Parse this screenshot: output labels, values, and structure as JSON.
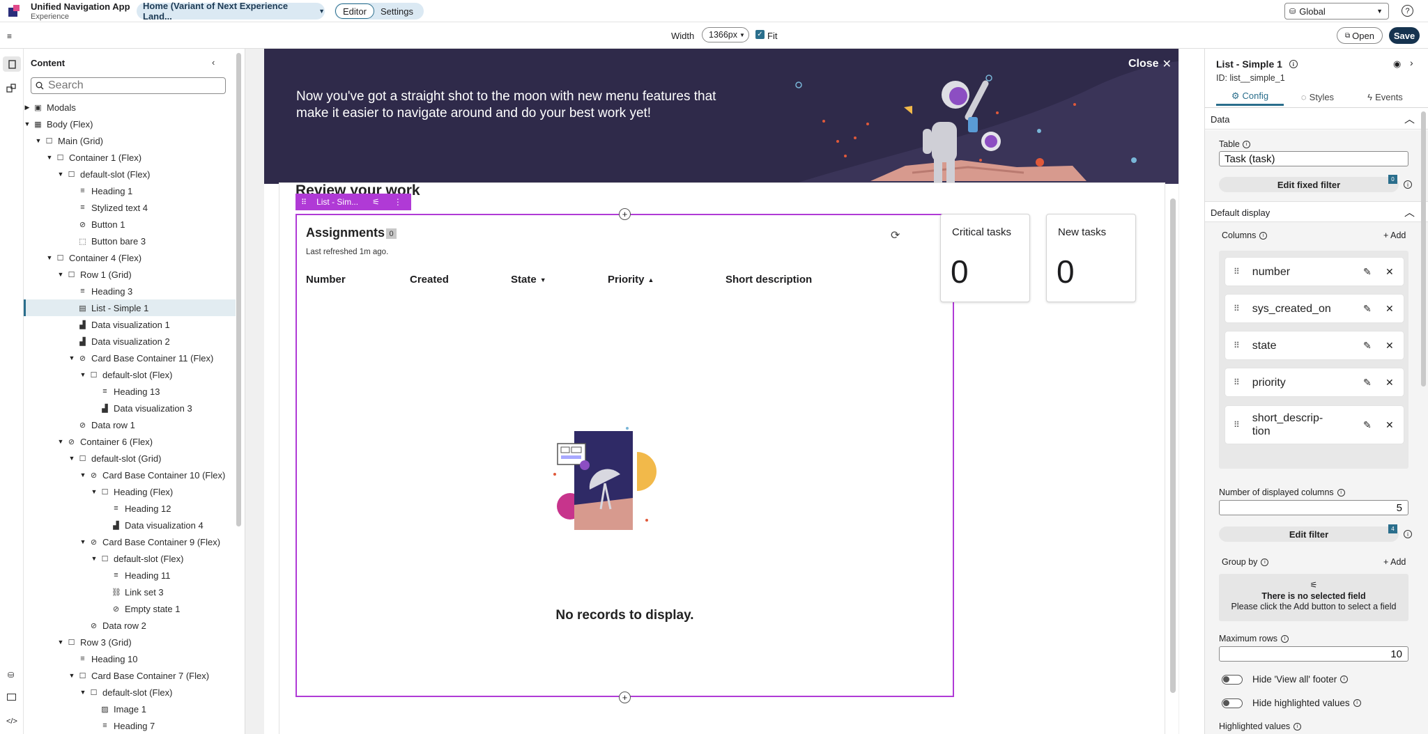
{
  "app": {
    "title": "Unified Navigation App",
    "subtitle": "Experience",
    "page_selector": "Home (Variant of Next Experience Land...",
    "mode_editor": "Editor",
    "mode_settings": "Settings",
    "scope": "Global"
  },
  "toolbar": {
    "width_label": "Width",
    "width_value": "1366px",
    "fit_label": "Fit",
    "open_label": "Open",
    "save_label": "Save"
  },
  "content_panel": {
    "title": "Content",
    "search_placeholder": "Search",
    "tree": [
      {
        "label": "Modals",
        "depth": 0,
        "caret": "▶",
        "icon": "modal"
      },
      {
        "label": "Body (Flex)",
        "depth": 0,
        "caret": "▼",
        "icon": "layout"
      },
      {
        "label": "Main (Grid)",
        "depth": 1,
        "caret": "▼",
        "icon": "box"
      },
      {
        "label": "Container 1 (Flex)",
        "depth": 2,
        "caret": "▼",
        "icon": "box"
      },
      {
        "label": "default-slot (Flex)",
        "depth": 3,
        "caret": "▼",
        "icon": "box"
      },
      {
        "label": "Heading 1",
        "depth": 4,
        "caret": "",
        "icon": "text"
      },
      {
        "label": "Stylized text 4",
        "depth": 4,
        "caret": "",
        "icon": "text"
      },
      {
        "label": "Button 1",
        "depth": 4,
        "caret": "",
        "icon": "eye-off"
      },
      {
        "label": "Button bare 3",
        "depth": 4,
        "caret": "",
        "icon": "cursor"
      },
      {
        "label": "Container 4 (Flex)",
        "depth": 2,
        "caret": "▼",
        "icon": "box"
      },
      {
        "label": "Row 1 (Grid)",
        "depth": 3,
        "caret": "▼",
        "icon": "box"
      },
      {
        "label": "Heading 3",
        "depth": 4,
        "caret": "",
        "icon": "text"
      },
      {
        "label": "List - Simple 1",
        "depth": 4,
        "caret": "",
        "icon": "list",
        "selected": true
      },
      {
        "label": "Data visualization 1",
        "depth": 4,
        "caret": "",
        "icon": "viz"
      },
      {
        "label": "Data visualization 2",
        "depth": 4,
        "caret": "",
        "icon": "viz"
      },
      {
        "label": "Card Base Container 11 (Flex)",
        "depth": 4,
        "caret": "▼",
        "icon": "eye-off"
      },
      {
        "label": "default-slot (Flex)",
        "depth": 5,
        "caret": "▼",
        "icon": "box"
      },
      {
        "label": "Heading 13",
        "depth": 6,
        "caret": "",
        "icon": "text"
      },
      {
        "label": "Data visualization 3",
        "depth": 6,
        "caret": "",
        "icon": "viz"
      },
      {
        "label": "Data row 1",
        "depth": 4,
        "caret": "",
        "icon": "eye-off"
      },
      {
        "label": "Container 6 (Flex)",
        "depth": 3,
        "caret": "▼",
        "icon": "eye-off"
      },
      {
        "label": "default-slot (Grid)",
        "depth": 4,
        "caret": "▼",
        "icon": "box"
      },
      {
        "label": "Card Base Container 10 (Flex)",
        "depth": 5,
        "caret": "▼",
        "icon": "eye-off"
      },
      {
        "label": "Heading (Flex)",
        "depth": 6,
        "caret": "▼",
        "icon": "box"
      },
      {
        "label": "Heading 12",
        "depth": 7,
        "caret": "",
        "icon": "text"
      },
      {
        "label": "Data visualization 4",
        "depth": 7,
        "caret": "",
        "icon": "viz"
      },
      {
        "label": "Card Base Container 9 (Flex)",
        "depth": 5,
        "caret": "▼",
        "icon": "eye-off"
      },
      {
        "label": "default-slot (Flex)",
        "depth": 6,
        "caret": "▼",
        "icon": "box"
      },
      {
        "label": "Heading 11",
        "depth": 7,
        "caret": "",
        "icon": "text"
      },
      {
        "label": "Link set 3",
        "depth": 7,
        "caret": "",
        "icon": "link"
      },
      {
        "label": "Empty state 1",
        "depth": 7,
        "caret": "",
        "icon": "eye-off"
      },
      {
        "label": "Data row 2",
        "depth": 5,
        "caret": "",
        "icon": "eye-off"
      },
      {
        "label": "Row 3 (Grid)",
        "depth": 3,
        "caret": "▼",
        "icon": "box"
      },
      {
        "label": "Heading 10",
        "depth": 4,
        "caret": "",
        "icon": "text"
      },
      {
        "label": "Card Base Container 7 (Flex)",
        "depth": 4,
        "caret": "▼",
        "icon": "box"
      },
      {
        "label": "default-slot (Flex)",
        "depth": 5,
        "caret": "▼",
        "icon": "box"
      },
      {
        "label": "Image 1",
        "depth": 6,
        "caret": "",
        "icon": "image"
      },
      {
        "label": "Heading 7",
        "depth": 6,
        "caret": "",
        "icon": "text"
      }
    ]
  },
  "canvas": {
    "banner_text_1": "Now you've got a straight shot to the moon with new menu features that",
    "banner_text_2": "make it easier to navigate around and do your best work yet!",
    "close_label": "Close",
    "section_heading": "Review your work",
    "component_chip": "List - Sim...",
    "list": {
      "title": "Assignments",
      "count": "0",
      "refreshed": "Last refreshed 1m ago.",
      "columns": [
        "Number",
        "Created",
        "State",
        "Priority",
        "Short description"
      ],
      "empty": "No records to display."
    },
    "cards": [
      {
        "title": "Critical tasks",
        "value": "0"
      },
      {
        "title": "New tasks",
        "value": "0"
      }
    ]
  },
  "config": {
    "title": "List - Simple 1",
    "id_label": "ID: list__simple_1",
    "tabs": [
      "Config",
      "Styles",
      "Events"
    ],
    "section_data": "Data",
    "table_label": "Table",
    "table_value": "Task (task)",
    "fixed_filter_label": "Edit fixed filter",
    "fixed_filter_badge": "0",
    "section_default": "Default display",
    "columns_label": "Columns",
    "add_label": "Add",
    "columns": [
      "number",
      "sys_created_on",
      "state",
      "priority",
      "short_descrip-tion"
    ],
    "displayed_cols_label": "Number of displayed columns",
    "displayed_cols_value": "5",
    "edit_filter_label": "Edit filter",
    "edit_filter_badge": "4",
    "group_by_label": "Group by",
    "group_add": "Add",
    "no_field_title": "There is no selected field",
    "no_field_desc": "Please click the Add button to select a field",
    "max_rows_label": "Maximum rows",
    "max_rows_value": "10",
    "hide_view_all": "Hide 'View all' footer",
    "hide_highlighted": "Hide highlighted values",
    "highlighted_values": "Highlighted values"
  },
  "colors": {
    "accent": "#b03ad6",
    "banner": "#2f2a4a",
    "brand_blue": "#2a6e8c",
    "save": "#16334f"
  }
}
